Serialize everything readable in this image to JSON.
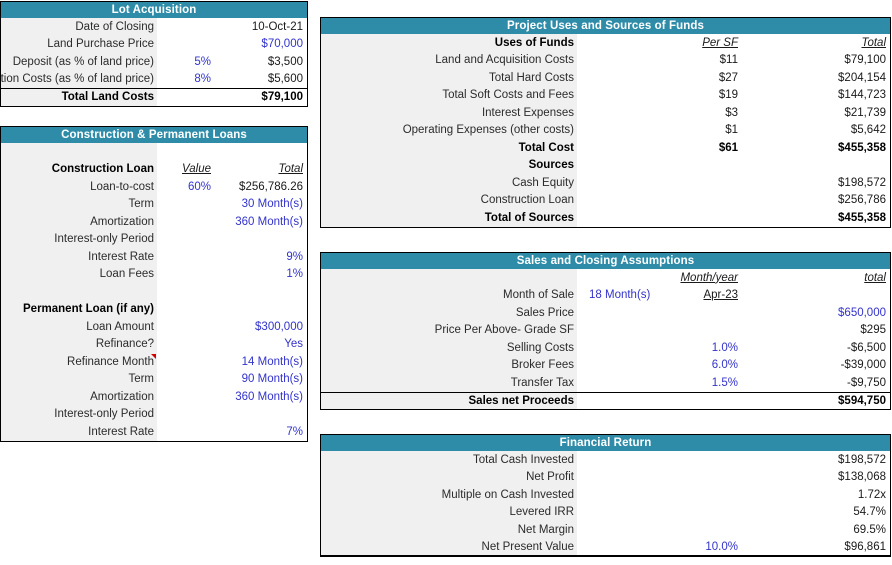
{
  "panels": {
    "lot_acquisition": {
      "title": "Lot Acquisition",
      "rows": [
        {
          "label": "Date of Closing",
          "mid": "",
          "total": "10-Oct-21"
        },
        {
          "label": "Land Purchase Price",
          "mid": "",
          "total": "$70,000"
        },
        {
          "label": "Deposit (as % of land price)",
          "mid": "5%",
          "total": "$3,500"
        },
        {
          "label": "Transaction Costs (as % of land price)",
          "mid": "8%",
          "total": "$5,600"
        },
        {
          "label": "Total Land Costs",
          "mid": "",
          "total": "$79,100"
        }
      ]
    },
    "construction_permanent_loans": {
      "title": "Construction & Permanent Loans",
      "construction_header": {
        "label": "Construction Loan",
        "mid": "Value ",
        "total": "Total"
      },
      "construction_rows": [
        {
          "label": "Loan-to-cost",
          "mid": "60%",
          "total": "$256,786.26"
        },
        {
          "label": "Term",
          "mid": "",
          "total": "30 Month(s)"
        },
        {
          "label": "Amortization",
          "mid": "",
          "total": "360 Month(s)"
        },
        {
          "label": "Interest-only Period",
          "mid": "",
          "total": ""
        },
        {
          "label": "Interest Rate",
          "mid": "",
          "total": "9%"
        },
        {
          "label": "Loan Fees",
          "mid": "",
          "total": "1%"
        }
      ],
      "permanent_header": "Permanent Loan (if any)",
      "permanent_rows": [
        {
          "label": "Loan Amount",
          "mid": "",
          "total": "$300,000"
        },
        {
          "label": "Refinance?",
          "mid": "",
          "total": "Yes"
        },
        {
          "label": "Refinance Month",
          "mid": "",
          "total": "14 Month(s)"
        },
        {
          "label": "Term",
          "mid": "",
          "total": "90 Month(s)"
        },
        {
          "label": "Amortization",
          "mid": "",
          "total": "360 Month(s)"
        },
        {
          "label": "Interest-only Period",
          "mid": "",
          "total": ""
        },
        {
          "label": "Interest Rate",
          "mid": "",
          "total": "7%"
        }
      ]
    },
    "project_uses_sources": {
      "title": "Project Uses and Sources of Funds",
      "uses_header": {
        "label": "Uses of Funds",
        "persf": "Per SF",
        "total": "Total"
      },
      "uses_rows": [
        {
          "label": "Land and Acquisition Costs",
          "persf": "$11",
          "total": "$79,100"
        },
        {
          "label": "Total Hard Costs",
          "persf": "$27",
          "total": "$204,154"
        },
        {
          "label": "Total Soft Costs and Fees",
          "persf": "$19",
          "total": "$144,723"
        },
        {
          "label": "Interest Expenses",
          "persf": "$3",
          "total": "$21,739"
        },
        {
          "label": "Operating Expenses (other costs)",
          "persf": "$1",
          "total": "$5,642"
        },
        {
          "label": "Total Cost",
          "persf": "$61",
          "total": "$455,358"
        }
      ],
      "sources_header": "Sources",
      "sources_rows": [
        {
          "label": "Cash Equity",
          "persf": "",
          "total": "$198,572"
        },
        {
          "label": "Construction Loan",
          "persf": "",
          "total": "$256,786"
        },
        {
          "label": "Total of Sources",
          "persf": "",
          "total": "$455,358"
        }
      ]
    },
    "sales_closing": {
      "title": "Sales and Closing Assumptions",
      "header": {
        "label": "",
        "value": "",
        "monthyear": "Month/year",
        "total": "total"
      },
      "rows": [
        {
          "label": "Month of Sale",
          "value": "18 Month(s)",
          "mid": "Apr-23",
          "total": ""
        },
        {
          "label": "Sales Price",
          "value": "",
          "mid": "",
          "total": "$650,000"
        },
        {
          "label": "Price Per Above- Grade SF",
          "value": "",
          "mid": "",
          "total": "$295"
        },
        {
          "label": "Selling Costs",
          "value": "",
          "mid": "1.0%",
          "total": "-$6,500"
        },
        {
          "label": "Broker Fees",
          "value": "",
          "mid": "6.0%",
          "total": "-$39,000"
        },
        {
          "label": "Transfer Tax",
          "value": "",
          "mid": "1.5%",
          "total": "-$9,750"
        },
        {
          "label": "Sales net Proceeds",
          "value": "",
          "mid": "",
          "total": "$594,750"
        }
      ]
    },
    "financial_return": {
      "title": "Financial Return",
      "rows": [
        {
          "label": "Total Cash Invested",
          "mid": "",
          "total": "$198,572"
        },
        {
          "label": "Net Profit",
          "mid": "",
          "total": "$138,068"
        },
        {
          "label": "Multiple on Cash Invested",
          "mid": "",
          "total": "1.72x"
        },
        {
          "label": "Levered IRR",
          "mid": "",
          "total": "54.7%"
        },
        {
          "label": "Net Margin",
          "mid": "",
          "total": "69.5%"
        },
        {
          "label": "Net Present Value",
          "mid": "10.0%",
          "total": "$96,861"
        }
      ]
    }
  },
  "colors": {
    "header_teal": "#2E8CA9",
    "label_fill": "#F0F0F0",
    "input_blue": "#3333CC",
    "comment_marker": "#D40000"
  }
}
